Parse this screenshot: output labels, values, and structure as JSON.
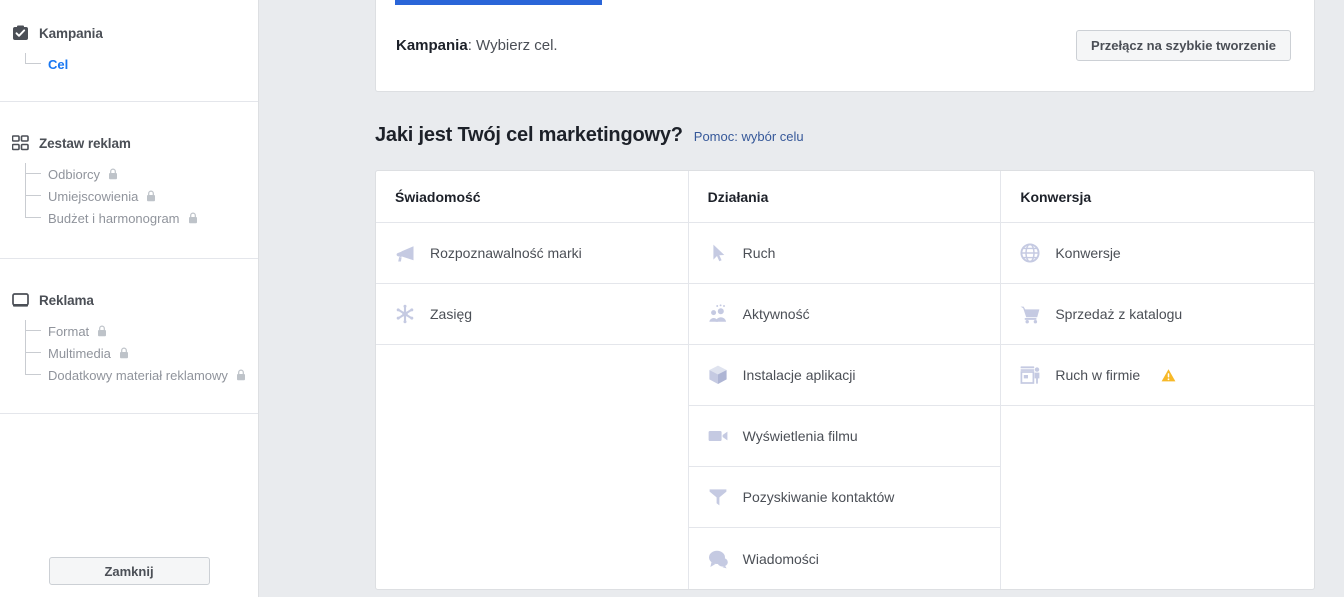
{
  "sidebar": {
    "sections": [
      {
        "icon": "clipboard-check-icon",
        "label": "Kampania",
        "items": [
          {
            "label": "Cel",
            "active": true,
            "locked": false
          }
        ]
      },
      {
        "icon": "grid-squares-icon",
        "label": "Zestaw reklam",
        "items": [
          {
            "label": "Odbiorcy",
            "active": false,
            "locked": true
          },
          {
            "label": "Umiejscowienia",
            "active": false,
            "locked": true
          },
          {
            "label": "Budżet i harmonogram",
            "active": false,
            "locked": true
          }
        ]
      },
      {
        "icon": "monitor-icon",
        "label": "Reklama",
        "items": [
          {
            "label": "Format",
            "active": false,
            "locked": true
          },
          {
            "label": "Multimedia",
            "active": false,
            "locked": true
          },
          {
            "label": "Dodatkowy materiał reklamowy",
            "active": false,
            "locked": true
          }
        ]
      }
    ],
    "close_label": "Zamknij"
  },
  "header": {
    "campaign_label": "Kampania",
    "campaign_rest": ": Wybierz cel.",
    "quick_create_label": "Przełącz na szybkie tworzenie"
  },
  "question": {
    "title": "Jaki jest Twój cel marketingowy?",
    "help_label": "Pomoc: wybór celu"
  },
  "objectives": {
    "columns": [
      {
        "header": "Świadomość",
        "items": [
          {
            "label": "Rozpoznawalność marki",
            "icon": "megaphone-icon",
            "warning": false
          },
          {
            "label": "Zasięg",
            "icon": "starburst-icon",
            "warning": false
          }
        ]
      },
      {
        "header": "Działania",
        "items": [
          {
            "label": "Ruch",
            "icon": "cursor-arrow-icon",
            "warning": false
          },
          {
            "label": "Aktywność",
            "icon": "people-icon",
            "warning": false
          },
          {
            "label": "Instalacje aplikacji",
            "icon": "cube-icon",
            "warning": false
          },
          {
            "label": "Wyświetlenia filmu",
            "icon": "video-camera-icon",
            "warning": false
          },
          {
            "label": "Pozyskiwanie kontaktów",
            "icon": "funnel-icon",
            "warning": false
          },
          {
            "label": "Wiadomości",
            "icon": "chat-bubbles-icon",
            "warning": false
          }
        ]
      },
      {
        "header": "Konwersja",
        "items": [
          {
            "label": "Konwersje",
            "icon": "globe-icon",
            "warning": false
          },
          {
            "label": "Sprzedaż z katalogu",
            "icon": "shopping-cart-icon",
            "warning": false
          },
          {
            "label": "Ruch w firmie",
            "icon": "storefront-icon",
            "warning": true
          }
        ]
      }
    ]
  },
  "colors": {
    "accent_blue": "#1877f2",
    "tab_indicator": "#2a65d8",
    "link_blue": "#365899",
    "icon_lavender": "#c5cae2",
    "warning_amber": "#f7b928",
    "page_bg": "#e9ebee"
  }
}
